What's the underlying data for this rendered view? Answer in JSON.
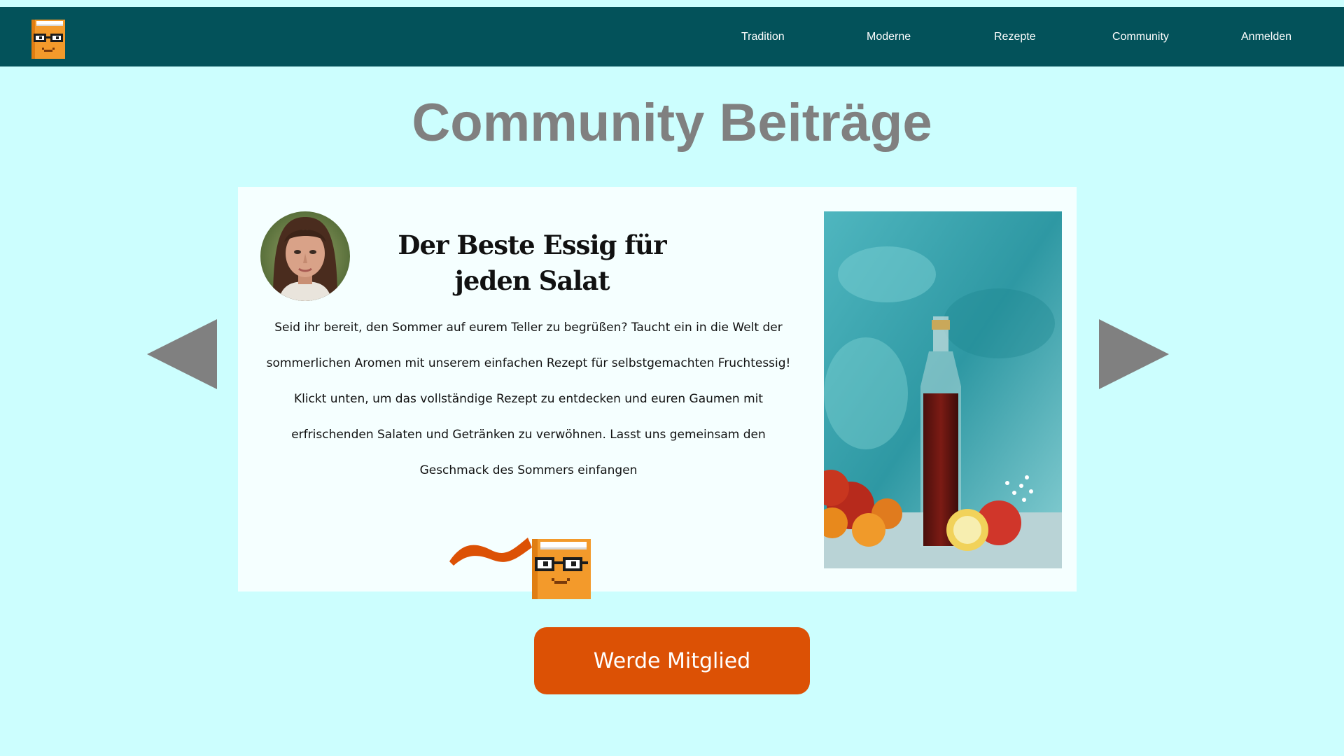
{
  "header": {
    "logo_icon": "book-mascot-icon",
    "nav": [
      {
        "label": "Tradition"
      },
      {
        "label": "Moderne"
      },
      {
        "label": "Rezepte"
      },
      {
        "label": "Community"
      },
      {
        "label": "Anmelden"
      }
    ]
  },
  "main": {
    "title": "Community Beiträge",
    "prev_icon": "triangle-left-icon",
    "next_icon": "triangle-right-icon",
    "post": {
      "title": "Der Beste Essig  für jeden Salat",
      "body": "Seid ihr bereit, den Sommer auf eurem Teller zu begrüßen? Taucht ein in die Welt der sommerlichen Aromen mit unserem einfachen Rezept für selbstgemachten Fruchtessig! Klickt unten, um das vollständige Rezept zu entdecken und euren Gaumen mit erfrischenden Salaten und Getränken zu verwöhnen. Lasst uns gemeinsam den Geschmack des Sommers einfangen",
      "avatar_icon": "author-avatar",
      "image_icon": "vinegar-bottle-photo"
    },
    "join_button": "Werde Mitglied"
  },
  "colors": {
    "background": "#ccfefe",
    "header": "#03525a",
    "title": "#808080",
    "card": "#f5ffff",
    "button": "#dc5105",
    "arrow": "#808080"
  }
}
